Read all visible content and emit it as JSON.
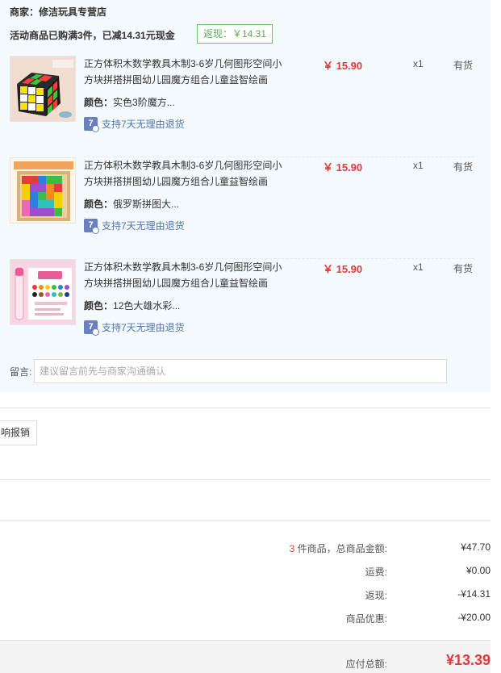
{
  "shop": {
    "merchant": "商家：修洁玩具专营店",
    "promo": "活动商品已购满3件，已减14.31元现金",
    "rebate_badge": "返现：￥14.31"
  },
  "items": [
    {
      "title": "正方体积木数学教具木制3-6岁几何图形空间小方块拼搭拼图幼儿园魔方组合儿童益智绘画",
      "color_label": "颜色：",
      "color_value": "实色3阶魔方...",
      "return_policy": "支持7天无理由退货",
      "price": "￥ 15.90",
      "qty": "x1",
      "stock": "有货",
      "thumb_icon": "rubiks-cube-image"
    },
    {
      "title": "正方体积木数学教具木制3-6岁几何图形空间小方块拼搭拼图幼儿园魔方组合儿童益智绘画",
      "color_label": "颜色：",
      "color_value": "俄罗斯拼图大...",
      "return_policy": "支持7天无理由退货",
      "price": "￥ 15.90",
      "qty": "x1",
      "stock": "有货",
      "thumb_icon": "tetris-puzzle-image"
    },
    {
      "title": "正方体积木数学教具木制3-6岁几何图形空间小方块拼搭拼图幼儿园魔方组合儿童益智绘画",
      "color_label": "颜色：",
      "color_value": "12色大雄水彩...",
      "return_policy": "支持7天无理由退货",
      "price": "￥ 15.90",
      "qty": "x1",
      "stock": "有货",
      "thumb_icon": "watercolor-set-image"
    }
  ],
  "message": {
    "label": "留言:",
    "placeholder": "建议留言前先与商家沟通确认"
  },
  "invoice_button": "响报销",
  "summary": {
    "count": "3",
    "count_suffix": " 件商品，总商品金额:",
    "subtotal": "¥47.70",
    "shipping_label": "运费:",
    "shipping": "¥0.00",
    "rebate_label": "返现:",
    "rebate": "-¥14.31",
    "discount_label": "商品优惠:",
    "discount": "-¥20.00",
    "total_label": "应付总额:",
    "total": "¥13.39"
  },
  "colors": {
    "accent_red": "#e4393c",
    "panel_bg": "#f3f9fd",
    "rebate_green": "#5aaa5a",
    "link_blue": "#5577aa"
  }
}
